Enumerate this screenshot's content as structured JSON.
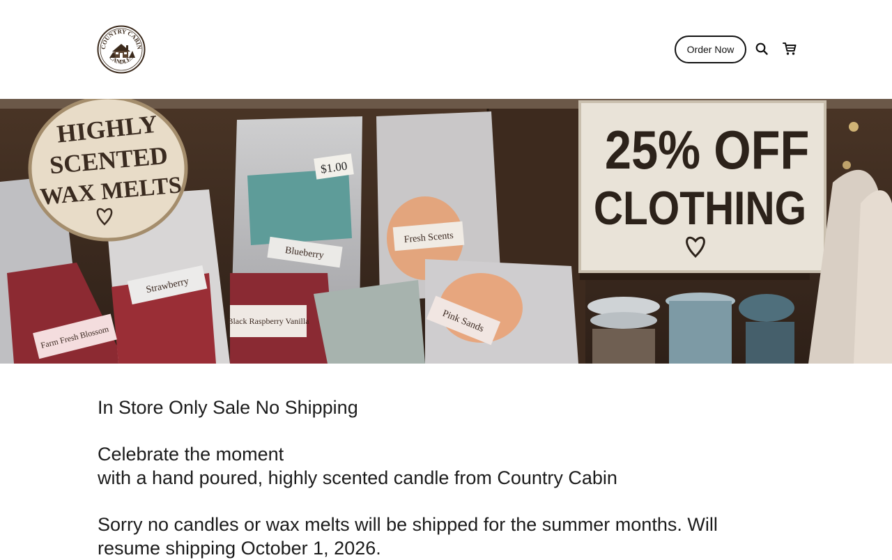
{
  "brand": {
    "logo_top_text": "COUNTRY CABIN",
    "logo_bottom_text": "CANDLES"
  },
  "header": {
    "order_button_label": "Order Now",
    "search_icon": "search-icon",
    "cart_icon": "cart-icon"
  },
  "hero": {
    "round_sign": [
      "HIGHLY",
      "SCENTED",
      "WAX MELTS"
    ],
    "sale_sign": [
      "25% OFF",
      "CLOTHING"
    ],
    "price_tag": "$1.00",
    "bag_labels": [
      "Fresh Scents",
      "Blueberry",
      "Strawberry",
      "Black Raspberry Vanilla",
      "Farm Fresh Blossom",
      "Pink Sands"
    ]
  },
  "content": {
    "headline": "In Store Only Sale No Shipping",
    "celebrate_line1": "Celebrate the moment",
    "celebrate_line2": "with a hand poured, highly scented candle from Country Cabin",
    "notice_line1": "Sorry no candles or wax melts will be shipped for the summer months. Will",
    "notice_line2": "resume shipping October 1, 2026."
  }
}
